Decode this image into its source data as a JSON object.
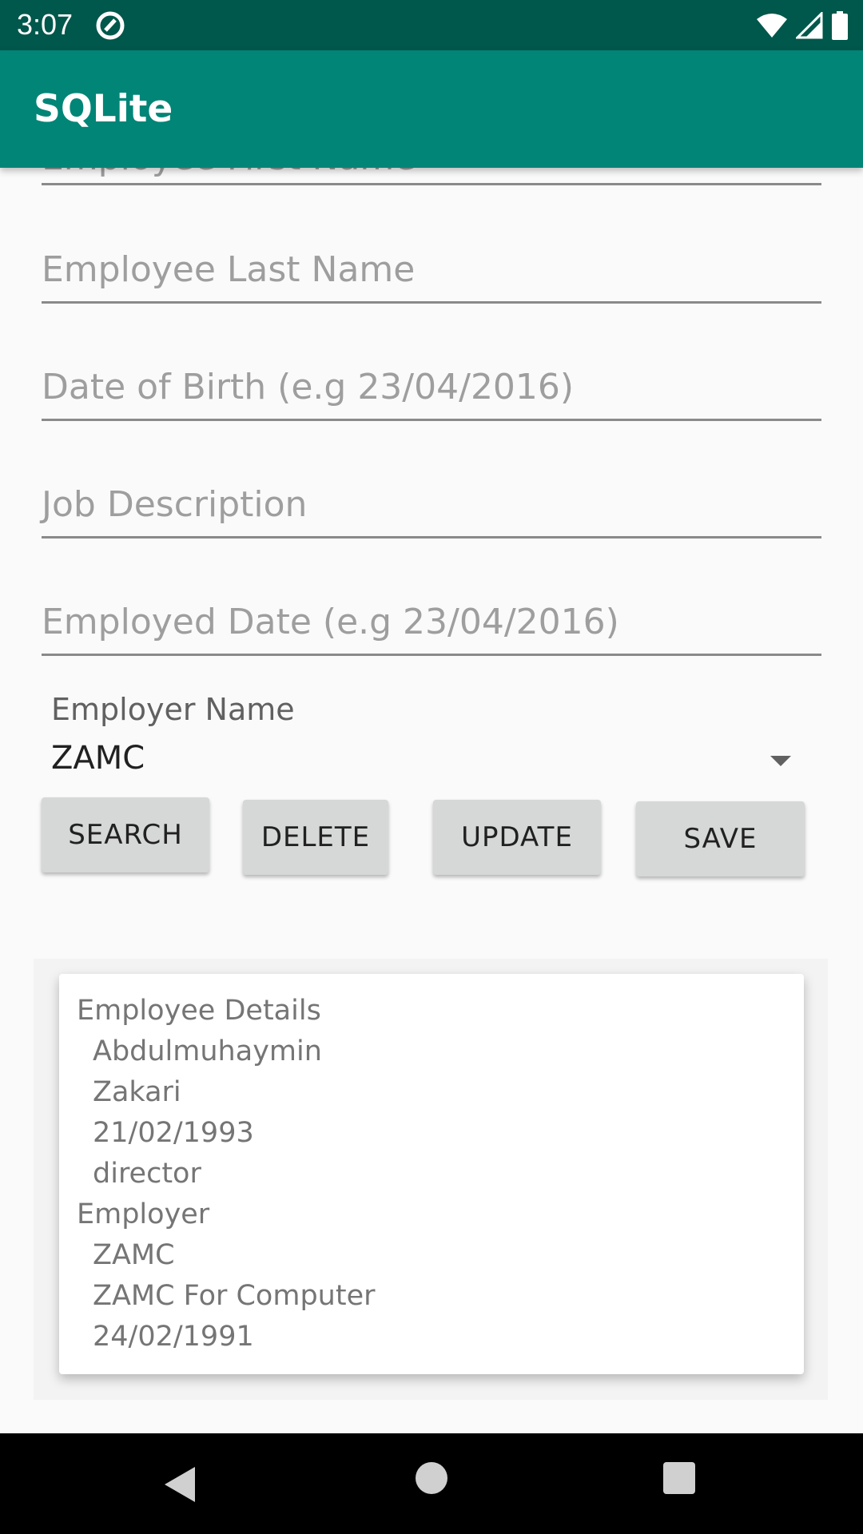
{
  "status_bar": {
    "time": "3:07",
    "icons": [
      "app-notification-icon",
      "wifi-icon",
      "signal-icon",
      "battery-icon"
    ]
  },
  "app_bar": {
    "title": "SQLite"
  },
  "form": {
    "fields": [
      {
        "placeholder": "Employee First Name"
      },
      {
        "placeholder": "Employee Last Name"
      },
      {
        "placeholder": "Date of Birth (e.g 23/04/2016)"
      },
      {
        "placeholder": "Job Description"
      },
      {
        "placeholder": "Employed Date (e.g 23/04/2016)"
      }
    ],
    "employer_label": "Employer Name",
    "employer_selected": "ZAMC"
  },
  "buttons": {
    "search": "SEARCH",
    "delete": "DELETE",
    "update": "UPDATE",
    "save": "SAVE"
  },
  "details": {
    "employee_heading": "Employee Details",
    "employee": {
      "first_name": "Abdulmuhaymin",
      "last_name": "Zakari",
      "dob": "21/02/1993",
      "job": "director"
    },
    "employer_heading": "Employer",
    "employer": {
      "name": "ZAMC",
      "description": "ZAMC For Computer",
      "date": "24/02/1991"
    }
  },
  "colors": {
    "status_bar": "#00574b",
    "app_bar": "#008577",
    "background": "#fafafa",
    "button": "#d6d7d7"
  }
}
